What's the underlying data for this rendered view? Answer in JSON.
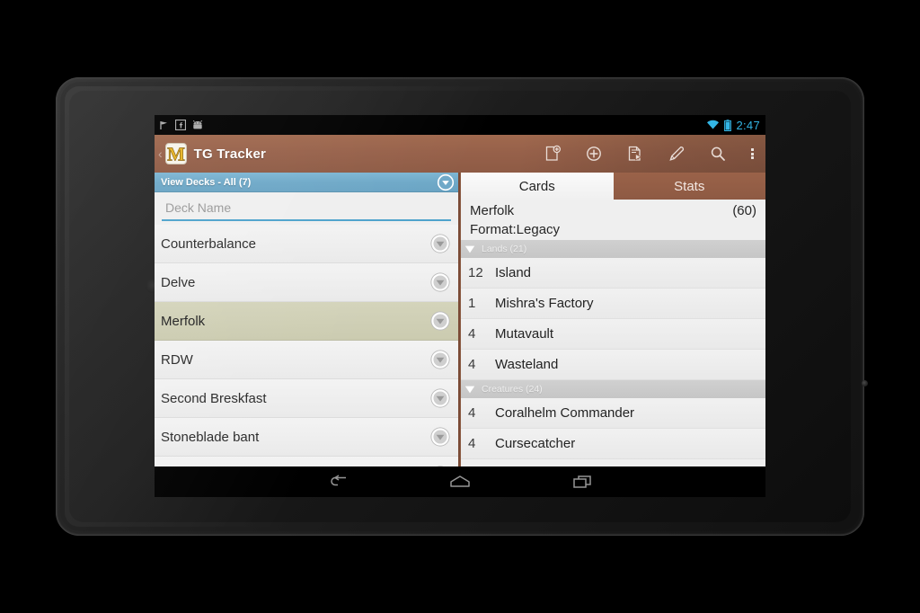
{
  "device": {
    "type": "android-tablet",
    "bezel_color": "#1d1d1d"
  },
  "statusbar": {
    "notification_icons": [
      "flag-icon",
      "facebook-icon",
      "android-robot-icon"
    ],
    "wifi_icon": "wifi-icon",
    "battery_icon": "battery-icon",
    "clock": "2:47",
    "accent_color": "#33b5e5"
  },
  "actionbar": {
    "back_chevron": "‹",
    "logo_icon": "m-logo-icon",
    "title": "TG Tracker",
    "bar_color": "#97614a",
    "actions": [
      {
        "name": "new-deck-icon",
        "label": "New Deck"
      },
      {
        "name": "add-card-icon",
        "label": "Add Card"
      },
      {
        "name": "play-deck-icon",
        "label": "Play Deck"
      },
      {
        "name": "edit-icon",
        "label": "Edit"
      },
      {
        "name": "search-icon",
        "label": "Search"
      }
    ],
    "overflow_label": "More options"
  },
  "left_pane": {
    "view_header": {
      "label": "View Decks - All (7)",
      "spinner_icon": "chevron-down-circle-icon",
      "color": "#6fa9c8"
    },
    "name_field": {
      "value": "",
      "placeholder": "Deck Name"
    },
    "decks": [
      {
        "name": "Counterbalance",
        "selected": false
      },
      {
        "name": "Delve",
        "selected": false
      },
      {
        "name": "Merfolk",
        "selected": true
      },
      {
        "name": "RDW",
        "selected": false
      },
      {
        "name": "Second Breskfast",
        "selected": false
      },
      {
        "name": "Stoneblade bant",
        "selected": false
      }
    ],
    "row_menu_icon": "chevron-down-circle-icon",
    "selected_row_color": "#cbcbb0"
  },
  "right_pane": {
    "tabs": [
      {
        "label": "Cards",
        "active": true
      },
      {
        "label": "Stats",
        "active": false
      }
    ],
    "deck_title": "Merfolk",
    "deck_count": "(60)",
    "deck_format": "Format:Legacy",
    "sections": [
      {
        "header": "Lands (21)",
        "caret_icon": "caret-down-icon",
        "cards": [
          {
            "qty": "12",
            "name": "Island"
          },
          {
            "qty": "1",
            "name": "Mishra's Factory"
          },
          {
            "qty": "4",
            "name": "Mutavault"
          },
          {
            "qty": "4",
            "name": "Wasteland"
          }
        ]
      },
      {
        "header": "Creatures (24)",
        "caret_icon": "caret-down-icon",
        "cards": [
          {
            "qty": "4",
            "name": "Coralhelm Commander"
          },
          {
            "qty": "4",
            "name": "Cursecatcher"
          }
        ]
      }
    ]
  },
  "navbar": {
    "buttons": [
      {
        "name": "nav-back-icon",
        "label": "Back"
      },
      {
        "name": "nav-home-icon",
        "label": "Home"
      },
      {
        "name": "nav-recents-icon",
        "label": "Recents"
      }
    ]
  }
}
